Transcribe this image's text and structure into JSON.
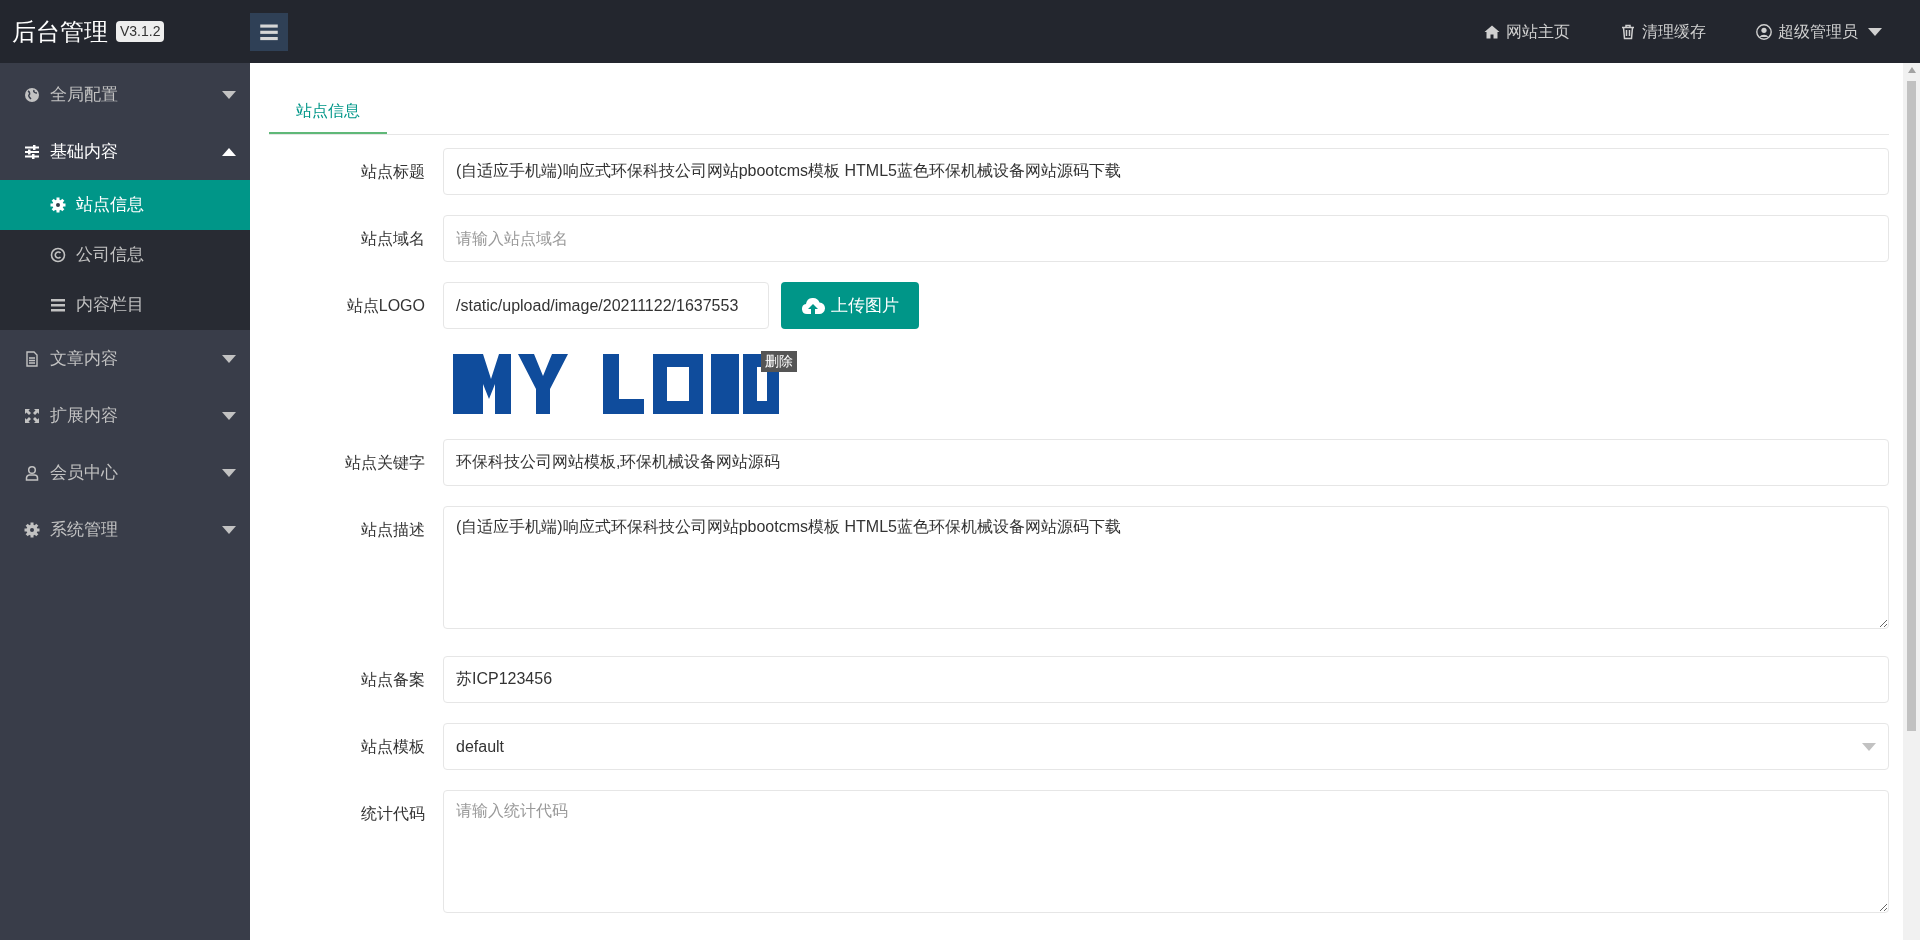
{
  "header": {
    "brand": "后台管理",
    "version": "V3.1.2",
    "links": [
      {
        "kind": "home",
        "label": "网站主页"
      },
      {
        "kind": "trash",
        "label": "清理缓存"
      },
      {
        "kind": "user",
        "label": "超级管理员",
        "dropdown": true
      }
    ]
  },
  "sidebar": {
    "items": [
      {
        "label": "全局配置",
        "expanded": false
      },
      {
        "label": "基础内容",
        "expanded": true,
        "children": [
          {
            "label": "站点信息",
            "selected": true
          },
          {
            "label": "公司信息",
            "selected": false
          },
          {
            "label": "内容栏目",
            "selected": false
          }
        ]
      },
      {
        "label": "文章内容",
        "expanded": false
      },
      {
        "label": "扩展内容",
        "expanded": false
      },
      {
        "label": "会员中心",
        "expanded": false
      },
      {
        "label": "系统管理",
        "expanded": false
      }
    ]
  },
  "tabs": [
    {
      "label": "站点信息",
      "selected": true
    }
  ],
  "form": [
    {
      "kind": "input",
      "label": "站点标题",
      "value": "(自适应手机端)响应式环保科技公司网站pbootcms模板 HTML5蓝色环保机械设备网站源码下载"
    },
    {
      "kind": "input",
      "label": "站点域名",
      "placeholder": "请输入站点域名"
    },
    {
      "kind": "upload",
      "label": "站点LOGO",
      "value": "/static/upload/image/20211122/1637553",
      "button": "上传图片",
      "delete": "删除"
    },
    {
      "kind": "input",
      "label": "站点关键字",
      "value": "环保科技公司网站模板,环保机械设备网站源码"
    },
    {
      "kind": "textarea",
      "label": "站点描述",
      "value": "(自适应手机端)响应式环保科技公司网站pbootcms模板 HTML5蓝色环保机械设备网站源码下载"
    },
    {
      "kind": "input",
      "label": "站点备案",
      "value": "苏ICP123456"
    },
    {
      "kind": "select",
      "label": "站点模板",
      "value": "default"
    },
    {
      "kind": "textarea",
      "label": "统计代码",
      "placeholder": "请输入统计代码"
    }
  ]
}
